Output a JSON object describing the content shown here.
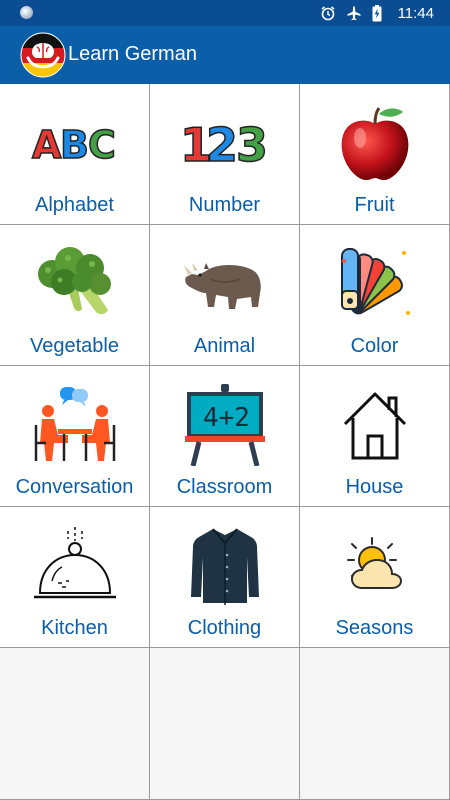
{
  "status_bar": {
    "time": "11:44",
    "icons": [
      "alarm-icon",
      "airplane-mode-icon",
      "battery-charging-icon"
    ]
  },
  "app_bar": {
    "title": "Learn German",
    "logo_icon": "german-flag-brain-logo-icon"
  },
  "colors": {
    "status_bar": "#0b4d93",
    "app_bar": "#0b5ea8",
    "label_text": "#0b5ea8",
    "grid_line": "#9a9a9a"
  },
  "categories": [
    {
      "label": "Alphabet",
      "icon": "abc-letters-icon"
    },
    {
      "label": "Number",
      "icon": "123-numbers-icon"
    },
    {
      "label": "Fruit",
      "icon": "apple-icon"
    },
    {
      "label": "Vegetable",
      "icon": "broccoli-icon"
    },
    {
      "label": "Animal",
      "icon": "rhinoceros-icon"
    },
    {
      "label": "Color",
      "icon": "color-swatch-fan-icon"
    },
    {
      "label": "Conversation",
      "icon": "two-people-talking-icon"
    },
    {
      "label": "Classroom",
      "icon": "chalkboard-icon"
    },
    {
      "label": "House",
      "icon": "house-outline-icon"
    },
    {
      "label": "Kitchen",
      "icon": "serving-cloche-icon"
    },
    {
      "label": "Clothing",
      "icon": "shirt-icon"
    },
    {
      "label": "Seasons",
      "icon": "sun-behind-cloud-icon"
    }
  ]
}
